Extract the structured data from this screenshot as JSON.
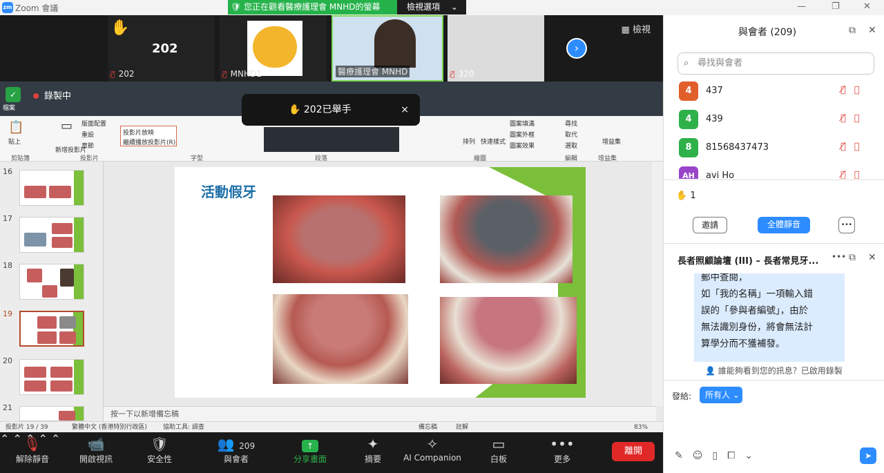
{
  "window": {
    "title": "Zoom 會議",
    "logo": "zm"
  },
  "banner": {
    "text": "您正在觀看醫療護理會 MNHD的螢幕",
    "view_options": "檢視選項"
  },
  "strip": {
    "view_label": "檢視",
    "tiles": [
      {
        "name": "202",
        "big": "202",
        "hand": "✋"
      },
      {
        "name": "MNHD1"
      },
      {
        "name": "醫療護理會 MNHD"
      },
      {
        "name": "320"
      }
    ]
  },
  "recording": {
    "badge_label": "檔案",
    "text": "錄製中"
  },
  "toast": {
    "text": "202已舉手",
    "close": "×"
  },
  "ribbon": {
    "groups": [
      "剪貼簿",
      "投影片",
      "字型",
      "段落",
      "繪圖",
      "編輯",
      "增益集"
    ],
    "items": [
      "貼上",
      "新增投影片",
      "版面配置",
      "重設",
      "章節",
      "投影片放映",
      "繼續播放投影片(R)",
      "尋找",
      "取代",
      "選取",
      "排列",
      "快速樣式",
      "圖案填滿",
      "圖案外框",
      "圖案效果",
      "增益集"
    ]
  },
  "slides": [
    {
      "num": "16"
    },
    {
      "num": "17"
    },
    {
      "num": "18"
    },
    {
      "num": "19"
    },
    {
      "num": "20"
    },
    {
      "num": "21"
    }
  ],
  "slide": {
    "title": "活動假牙"
  },
  "notes": {
    "placeholder": "按一下以新增備忘稿"
  },
  "status": {
    "slide_count": "投影片 19 / 39",
    "language": "繁體中文 (香港特別行政區)",
    "accessibility": "協助工具: 調查",
    "notes_btn": "備忘稿",
    "comments_btn": "註解",
    "zoom": "83%"
  },
  "toolbar": {
    "unmute": "解除靜音",
    "start_video": "開啟視訊",
    "security": "安全性",
    "participants": "與會者",
    "participants_count": "209",
    "share": "分享畫面",
    "summary": "摘要",
    "ai": "AI Companion",
    "whiteboard": "白板",
    "more": "更多",
    "leave": "離開"
  },
  "panel": {
    "title": "與會者 (209)",
    "search_placeholder": "尋找與會者",
    "participants": [
      {
        "avatar": "4",
        "name": "437",
        "color": "#e15f2b"
      },
      {
        "avatar": "4",
        "name": "439",
        "color": "#2fb14a"
      },
      {
        "avatar": "8",
        "name": "81568437473",
        "color": "#2fb14a"
      },
      {
        "avatar": "AH",
        "name": "avi Ho",
        "color": "#9a45c9"
      }
    ],
    "raised_hands": "1",
    "invite": "邀請",
    "mute_all": "全體靜音",
    "more": "•••"
  },
  "chat": {
    "title": "長者照顧論壇 (III) – 長者常見牙...",
    "message_lines": [
      "郵中查閱，",
      "如「我的名稱」一項輸入錯",
      "誤的「參與者編號」，由於",
      "無法識別身份，將會無法計",
      "算學分而不獲補發。"
    ],
    "notice": "誰能夠看到您的訊息？已啟用錄製",
    "send_to_label": "發給:",
    "send_to_value": "所有人"
  }
}
